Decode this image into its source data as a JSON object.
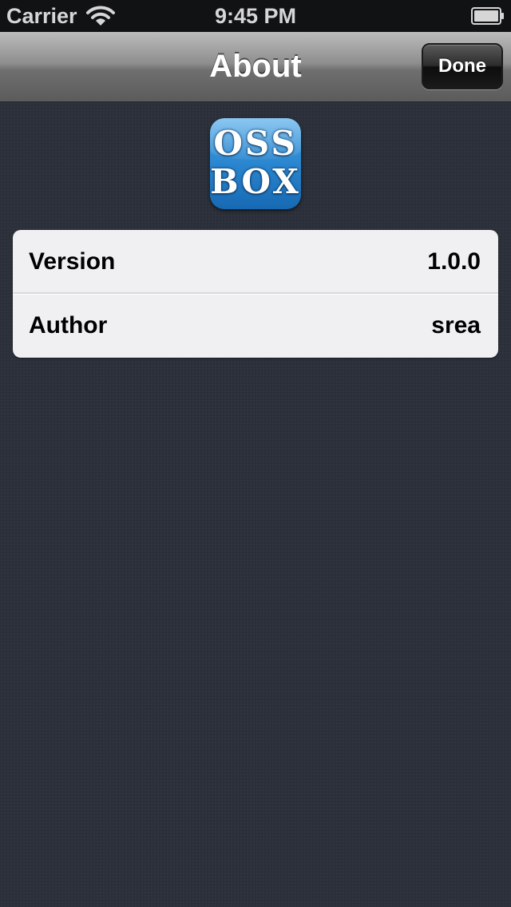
{
  "status_bar": {
    "carrier": "Carrier",
    "time": "9:45 PM",
    "wifi_icon": "wifi-icon",
    "battery_icon": "battery-icon"
  },
  "nav_bar": {
    "title": "About",
    "done_label": "Done"
  },
  "app_icon": {
    "line1": "OSS",
    "line2": "BOX",
    "color": "#2a86cf"
  },
  "info_table": {
    "rows": [
      {
        "label": "Version",
        "value": "1.0.0"
      },
      {
        "label": "Author",
        "value": "srea"
      }
    ]
  },
  "colors": {
    "background": "#2b303a",
    "table_background": "#f0f0f2",
    "status_bar": "#111214"
  }
}
